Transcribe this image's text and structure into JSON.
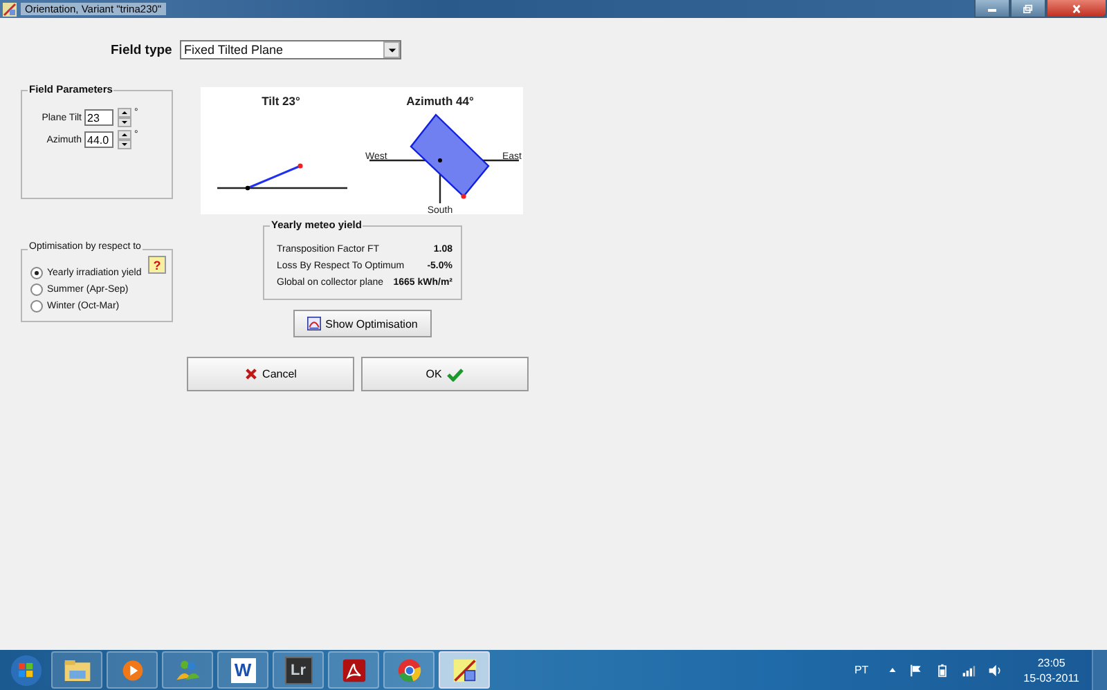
{
  "window": {
    "title": "Orientation, Variant \"trina230\""
  },
  "field_type": {
    "label": "Field type",
    "value": "Fixed Tilted Plane"
  },
  "field_parameters": {
    "title": "Field Parameters",
    "fields": [
      {
        "label": "Plane Tilt",
        "value": "23",
        "unit": "°"
      },
      {
        "label": "Azimuth",
        "value": "44.0",
        "unit": "°"
      }
    ]
  },
  "diagram": {
    "tilt_title": "Tilt 23°",
    "azimuth_title": "Azimuth 44°",
    "west": "West",
    "east": "East",
    "south": "South"
  },
  "optimisation": {
    "title": "Optimisation by respect to",
    "help": "?",
    "options": [
      {
        "label": "Yearly irradiation yield",
        "selected": true
      },
      {
        "label": "Summer (Apr-Sep)",
        "selected": false
      },
      {
        "label": "Winter (Oct-Mar)",
        "selected": false
      }
    ]
  },
  "yearly": {
    "title": "Yearly meteo yield",
    "rows": [
      {
        "label": "Transposition Factor FT",
        "value": "1.08"
      },
      {
        "label": "Loss By Respect To Optimum",
        "value": "-5.0%"
      },
      {
        "label": "Global on collector plane",
        "value": "1665 kWh/m²"
      }
    ]
  },
  "show_button": "Show Optimisation",
  "buttons": [
    {
      "kind": "cancel",
      "label": "Cancel"
    },
    {
      "kind": "ok",
      "label": "OK"
    }
  ],
  "taskbar": {
    "apps": [
      {
        "kind": "explorer",
        "selected": false
      },
      {
        "kind": "media",
        "selected": false
      },
      {
        "kind": "messenger",
        "selected": false
      },
      {
        "kind": "word",
        "glyph": "W",
        "selected": false
      },
      {
        "kind": "lightroom",
        "glyph": "Lr",
        "selected": false
      },
      {
        "kind": "acrobat",
        "selected": false
      },
      {
        "kind": "chrome",
        "selected": false
      },
      {
        "kind": "pvsyst",
        "selected": true
      }
    ],
    "language": "PT",
    "time": "23:05",
    "date": "15-03-2011"
  }
}
